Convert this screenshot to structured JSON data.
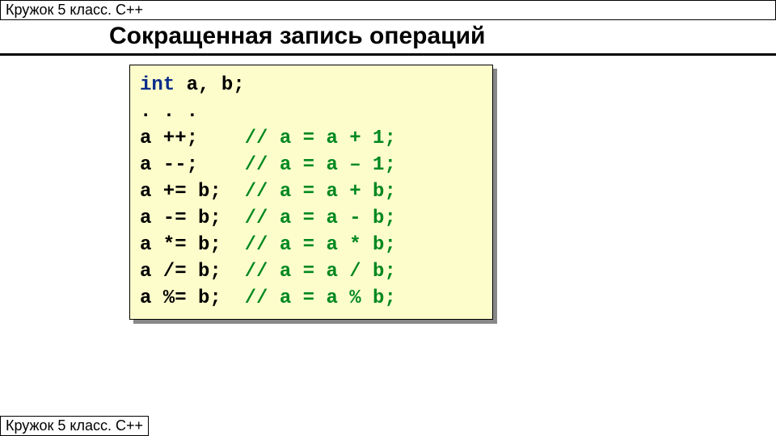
{
  "header": {
    "text": "Кружок 5 класс. С++"
  },
  "footer": {
    "text": "Кружок 5 класс. С++"
  },
  "title": "Сокращенная запись операций",
  "code": {
    "kw": "int",
    "decl": " a, b;",
    "dots": ". . .",
    "l1": {
      "stmt": "a ++;    ",
      "cm": "// a = a + 1;"
    },
    "l2": {
      "stmt": "a --;    ",
      "cm": "// a = a – 1;"
    },
    "l3": {
      "stmt": "a += b;  ",
      "cm": "// a = a + b;"
    },
    "l4": {
      "stmt": "a -= b;  ",
      "cm": "// a = a - b;"
    },
    "l5": {
      "stmt": "a *= b;  ",
      "cm": "// a = a * b;"
    },
    "l6": {
      "stmt": "a /= b;  ",
      "cm": "// a = a / b;"
    },
    "l7": {
      "stmt": "a %= b;  ",
      "cm": "// a = a % b;"
    }
  }
}
